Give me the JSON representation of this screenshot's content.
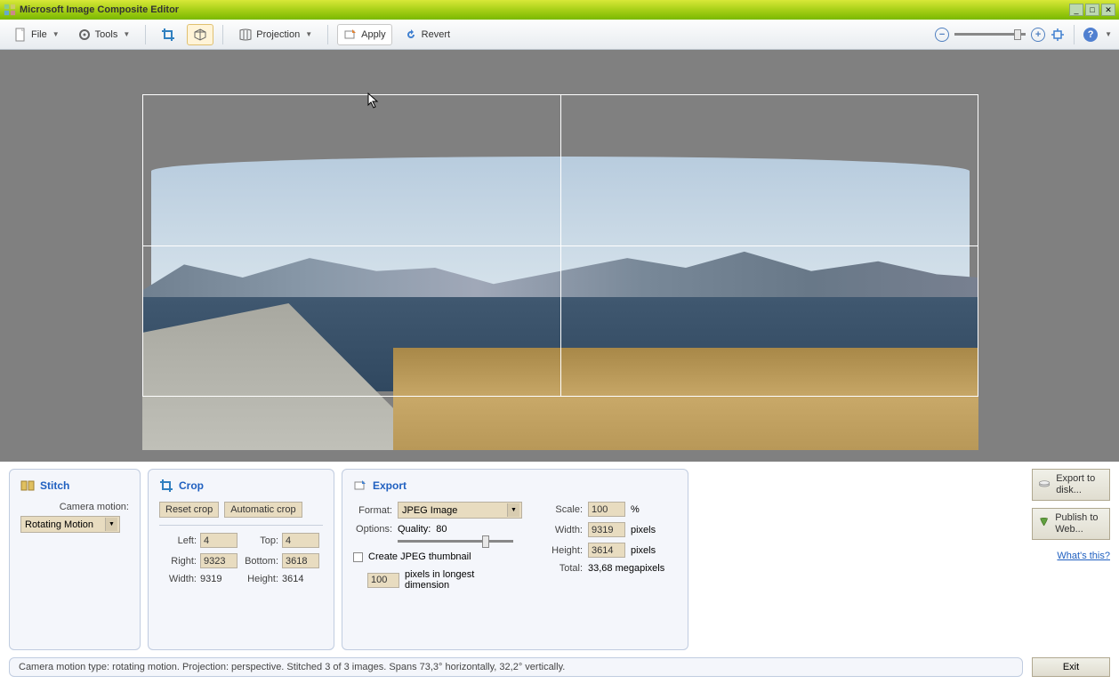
{
  "title": "Microsoft Image Composite Editor",
  "toolbar": {
    "file": "File",
    "tools": "Tools",
    "projection": "Projection",
    "apply": "Apply",
    "revert": "Revert"
  },
  "panels": {
    "stitch": {
      "title": "Stitch",
      "camera_motion_label": "Camera motion:",
      "camera_motion_value": "Rotating Motion"
    },
    "crop": {
      "title": "Crop",
      "reset": "Reset crop",
      "auto": "Automatic crop",
      "left_label": "Left:",
      "left": "4",
      "top_label": "Top:",
      "top": "4",
      "right_label": "Right:",
      "right": "9323",
      "bottom_label": "Bottom:",
      "bottom": "3618",
      "width_label": "Width:",
      "width": "9319",
      "height_label": "Height:",
      "height": "3614"
    },
    "export": {
      "title": "Export",
      "format_label": "Format:",
      "format_value": "JPEG Image",
      "options_label": "Options:",
      "quality_label": "Quality:",
      "quality_value": "80",
      "scale_label": "Scale:",
      "scale_value": "100",
      "scale_unit": "%",
      "width_label": "Width:",
      "width_value": "9319",
      "width_unit": "pixels",
      "height_label": "Height:",
      "height_value": "3614",
      "height_unit": "pixels",
      "total_label": "Total:",
      "total_value": "33,68 megapixels",
      "thumb_label": "Create JPEG thumbnail",
      "thumb_px": "100",
      "thumb_desc": "pixels in longest dimension"
    }
  },
  "sidebtns": {
    "export_disk": "Export to disk...",
    "publish_web": "Publish to Web...",
    "whats_this": "What's this?"
  },
  "status": "Camera motion type: rotating motion. Projection: perspective. Stitched 3 of 3 images. Spans 73,3° horizontally, 32,2° vertically.",
  "exit": "Exit"
}
